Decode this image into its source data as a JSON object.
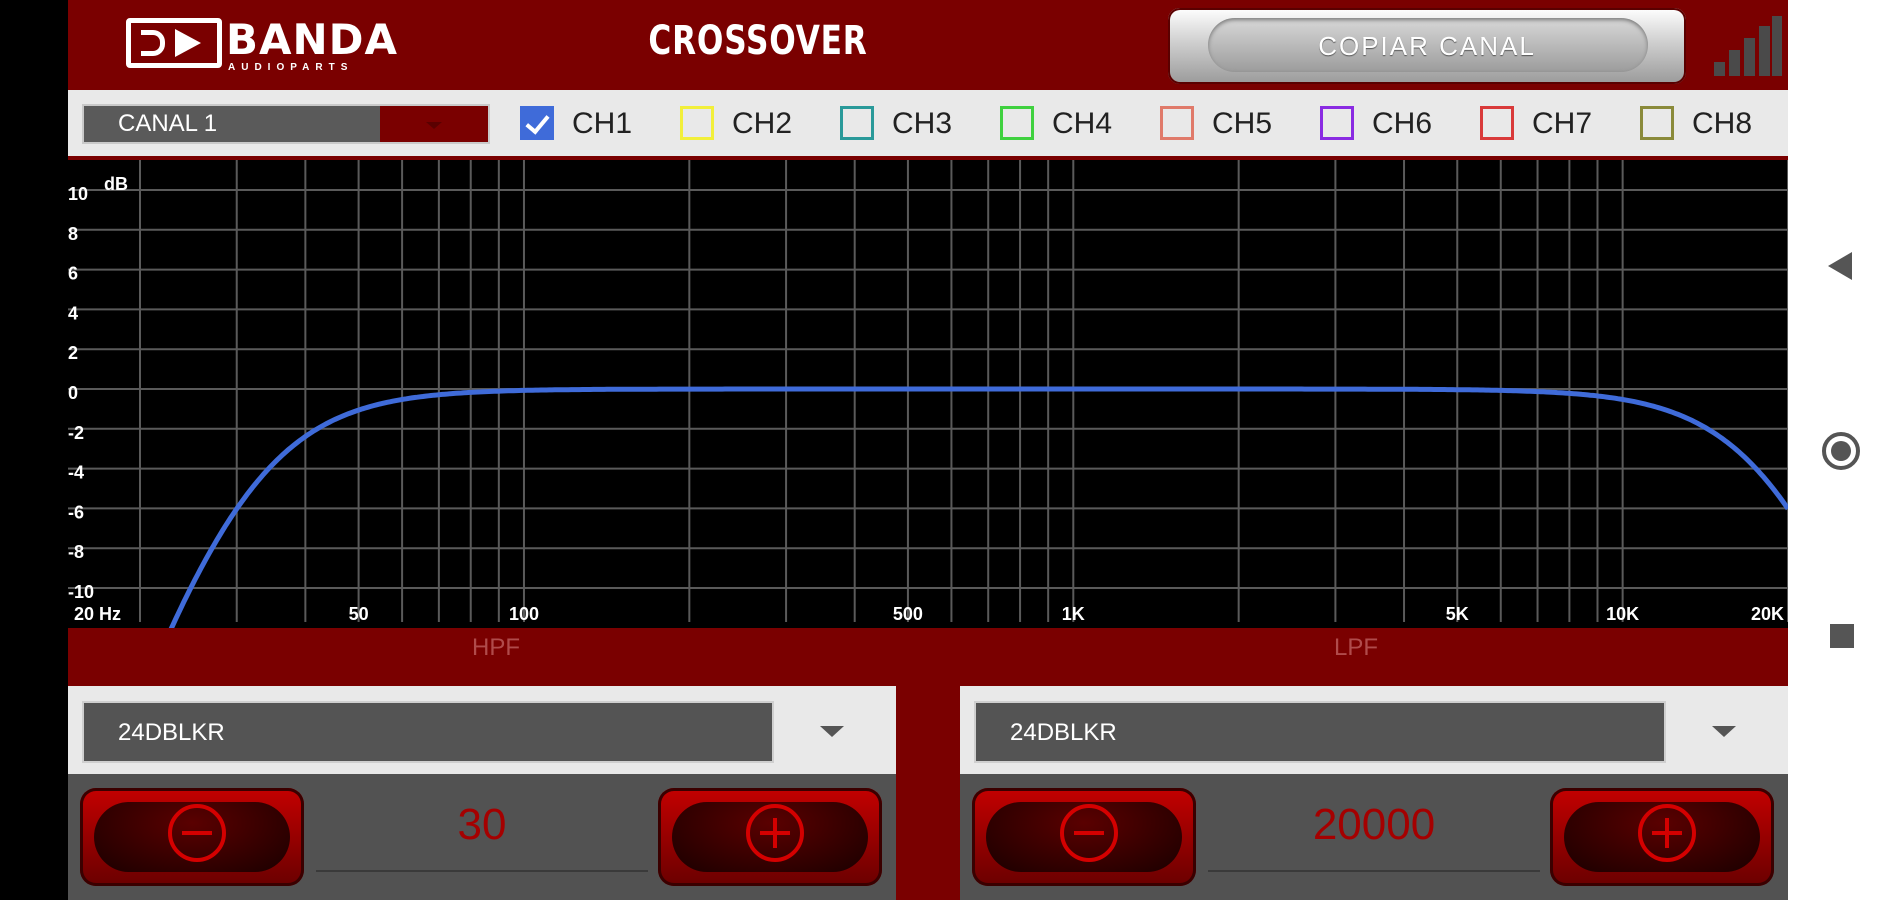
{
  "header": {
    "brand_name": "BANDA",
    "brand_sub": "AUDIOPARTS",
    "title": "CROSSOVER",
    "copy_button": "COPIAR CANAL"
  },
  "channel_select": {
    "value": "CANAL  1"
  },
  "channels": [
    {
      "label": "CH1",
      "color": "#3f6bd9",
      "checked": true
    },
    {
      "label": "CH2",
      "color": "#f2ef3a",
      "checked": false
    },
    {
      "label": "CH3",
      "color": "#2a9a9a",
      "checked": false
    },
    {
      "label": "CH4",
      "color": "#3fd13f",
      "checked": false
    },
    {
      "label": "CH5",
      "color": "#e07a6a",
      "checked": false
    },
    {
      "label": "CH6",
      "color": "#8a2be2",
      "checked": false
    },
    {
      "label": "CH7",
      "color": "#d93a3a",
      "checked": false
    },
    {
      "label": "CH8",
      "color": "#8a8a3a",
      "checked": false
    }
  ],
  "graph": {
    "unit": "dB",
    "y_labels": [
      "10",
      "8",
      "6",
      "4",
      "2",
      "0",
      "-2",
      "-4",
      "-6",
      "-8",
      "-10"
    ],
    "x_labels": [
      "20 Hz",
      "50",
      "100",
      "500",
      "1K",
      "5K",
      "10K",
      "20K"
    ],
    "curve_color": "#3f6bd9",
    "hpf_hz": 30,
    "lpf_hz": 20000
  },
  "hpf": {
    "label": "HPF",
    "filter_type": "24DBLKR",
    "value": "30"
  },
  "lpf": {
    "label": "LPF",
    "filter_type": "24DBLKR",
    "value": "20000"
  }
}
